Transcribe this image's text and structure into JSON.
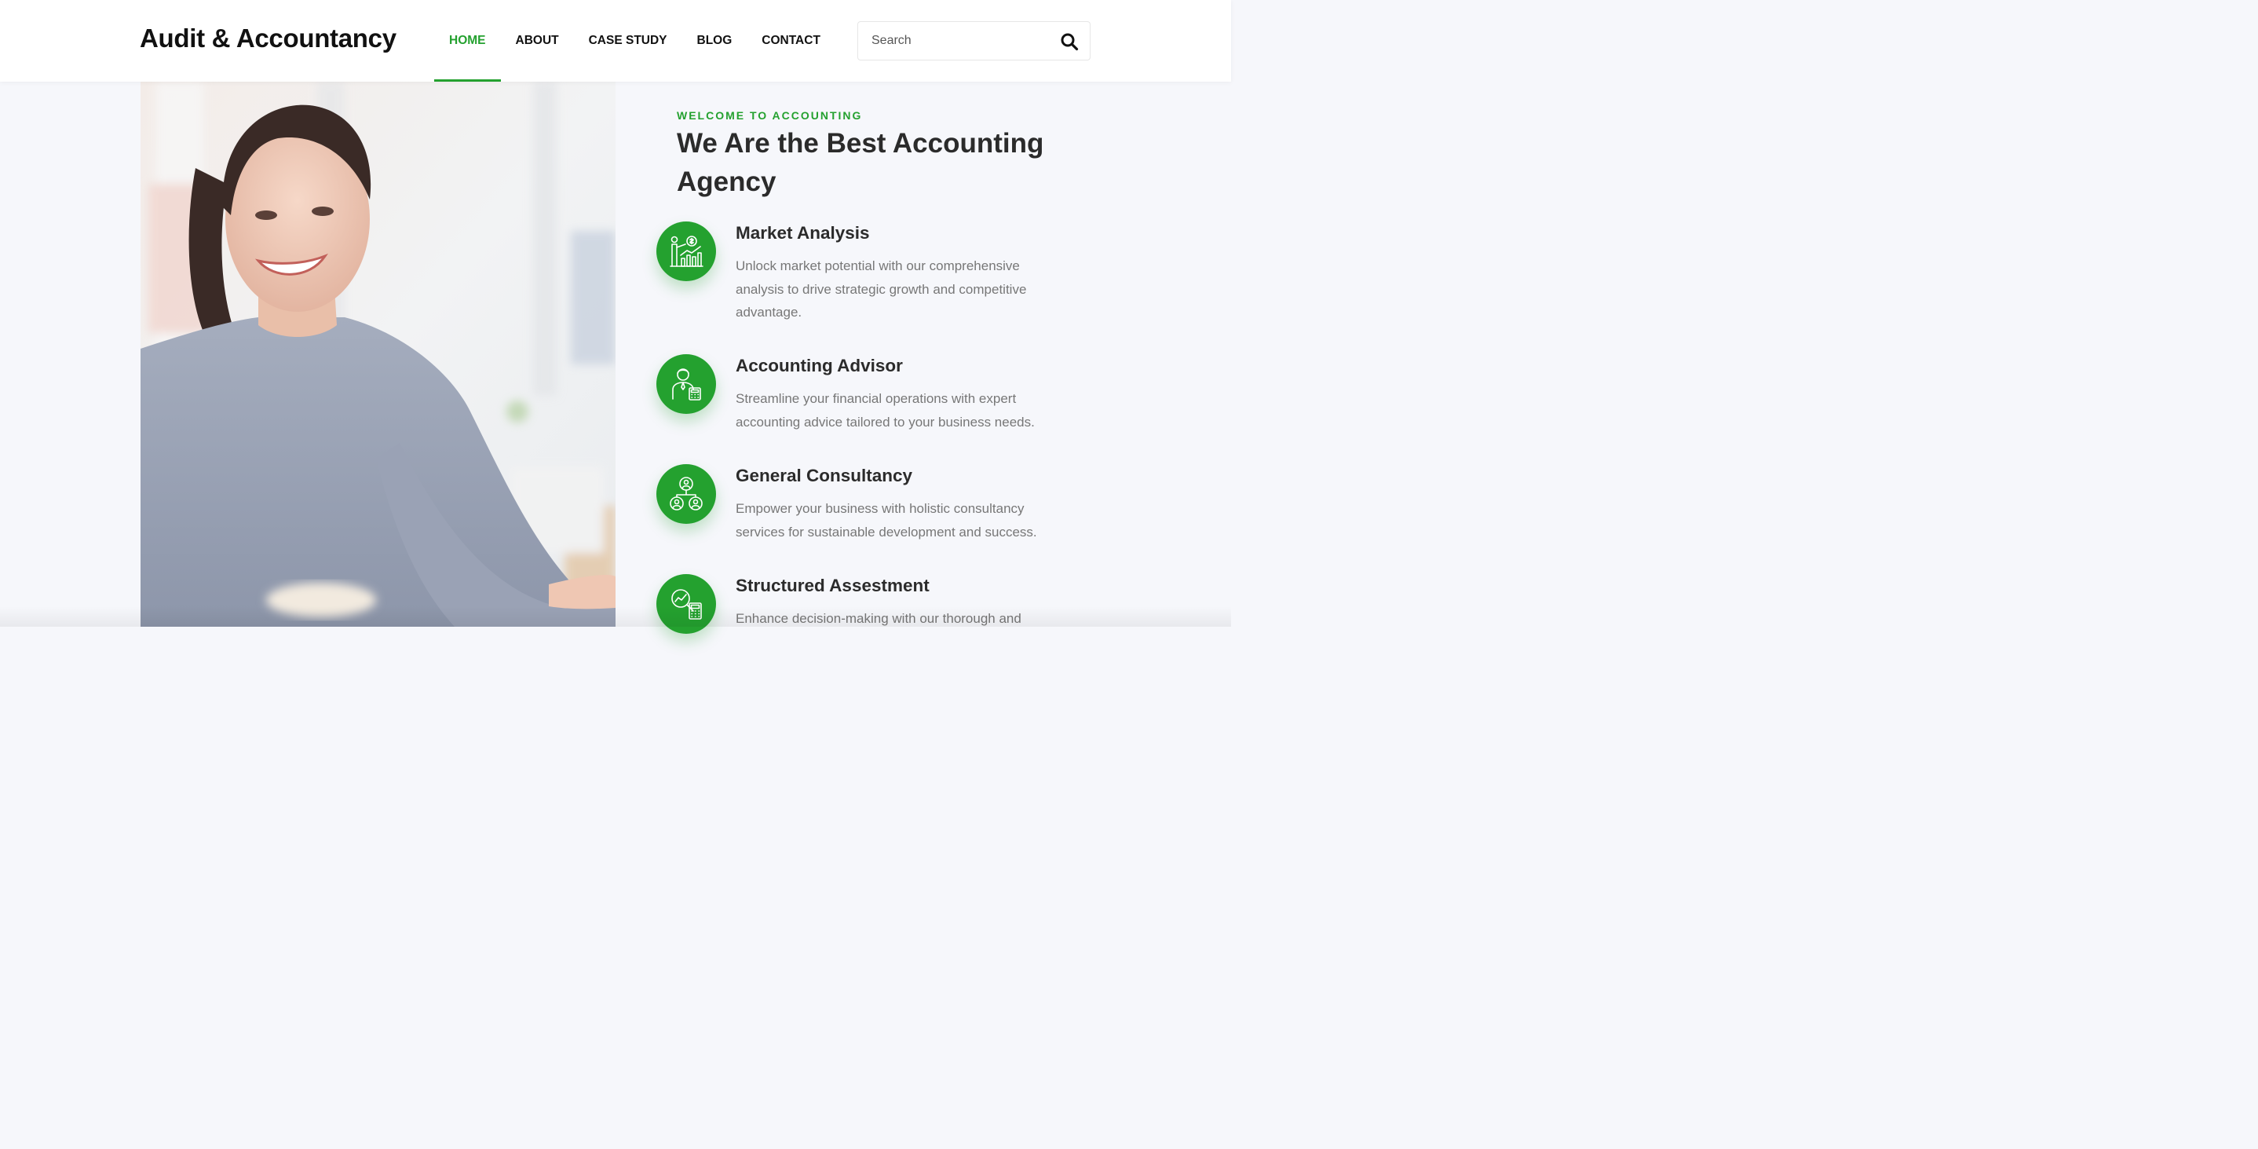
{
  "brand": {
    "name": "Audit & Accountancy"
  },
  "nav": {
    "items": [
      {
        "label": "HOME",
        "active": true
      },
      {
        "label": "ABOUT",
        "active": false
      },
      {
        "label": "CASE STUDY",
        "active": false
      },
      {
        "label": "BLOG",
        "active": false
      },
      {
        "label": "CONTACT",
        "active": false
      }
    ]
  },
  "search": {
    "placeholder": "Search",
    "icon": "search-icon"
  },
  "hero": {
    "eyebrow": "WELCOME TO ACCOUNTING",
    "title": "We Are the Best Accounting Agency"
  },
  "services": [
    {
      "icon": "market-analysis-icon",
      "title": "Market Analysis",
      "text": "Unlock market potential with our comprehensive analysis to drive strategic growth and competitive advantage."
    },
    {
      "icon": "accounting-advisor-icon",
      "title": "Accounting Advisor",
      "text": "Streamline your financial operations with expert accounting advice tailored to your business needs."
    },
    {
      "icon": "consultancy-network-icon",
      "title": "General Consultancy",
      "text": "Empower your business with holistic consultancy services for sustainable development and success."
    },
    {
      "icon": "assessment-magnifier-icon",
      "title": "Structured Assestment",
      "text": "Enhance decision-making with our thorough and"
    }
  ],
  "colors": {
    "accent": "#24a12f",
    "heading": "#2b2b2b",
    "body_text": "#777777",
    "page_bg": "#f6f7fb"
  }
}
